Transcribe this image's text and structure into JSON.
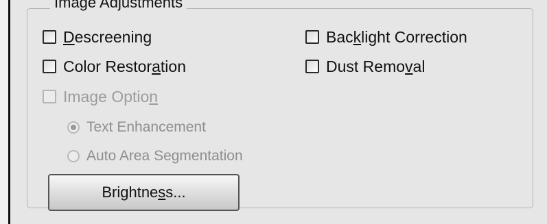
{
  "group": {
    "title": "Image Adjustments"
  },
  "checkboxes": {
    "descreening": {
      "pre": "",
      "mnemonic": "D",
      "post": "escreening"
    },
    "backlight": {
      "pre": "Bac",
      "mnemonic": "k",
      "post": "light Correction"
    },
    "color_restoration": {
      "pre": "Color Restor",
      "mnemonic": "a",
      "post": "tion"
    },
    "dust_removal": {
      "pre": "Dust Remo",
      "mnemonic": "v",
      "post": "al"
    },
    "image_option": {
      "pre": "Image Optio",
      "mnemonic": "n",
      "post": ""
    }
  },
  "radios": {
    "text_enhancement": "Text Enhancement",
    "auto_area": "Auto Area Segmentation"
  },
  "brightness_button": {
    "pre": "Brightne",
    "mnemonic": "s",
    "post": "s..."
  }
}
